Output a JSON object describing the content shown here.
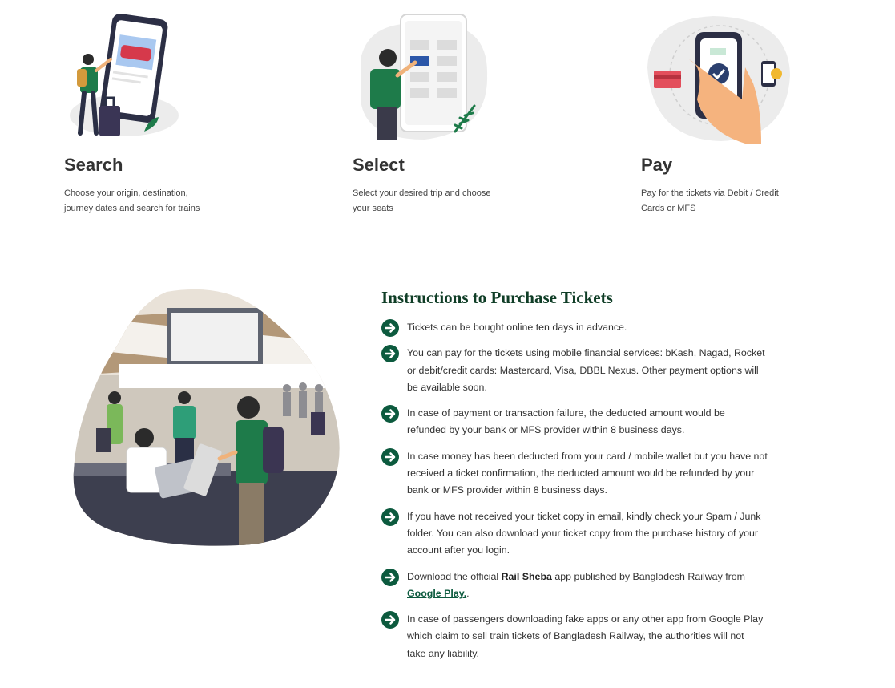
{
  "steps": [
    {
      "title": "Search",
      "description_line1": "Choose your origin, destination,",
      "description_line2": "journey dates and search for trains",
      "icon": "search-illustration"
    },
    {
      "title": "Select",
      "description_line1": "Select your desired trip and choose",
      "description_line2": "your seats",
      "icon": "select-illustration"
    },
    {
      "title": "Pay",
      "description_line1": "Pay for the tickets via Debit / Credit",
      "description_line2": "Cards or MFS",
      "icon": "pay-illustration"
    }
  ],
  "instructions": {
    "title": "Instructions to Purchase Tickets",
    "items": [
      {
        "lines": [
          "Tickets can be bought online ten days in advance."
        ]
      },
      {
        "lines": [
          "You can pay for the tickets using mobile financial services: bKash, Nagad, Rocket",
          "or debit/credit cards: Mastercard, Visa, DBBL Nexus. Other payment options will",
          "be available soon."
        ]
      },
      {
        "lines": [
          "In case of payment or transaction failure, the deducted amount would be",
          "refunded by your bank or MFS provider within 8 business days."
        ]
      },
      {
        "lines": [
          "In case money has been deducted from your card / mobile wallet but you have not",
          "received a ticket confirmation, the deducted amount would be refunded by your",
          "bank or MFS provider within 8 business days."
        ]
      },
      {
        "lines": [
          "If you have not received your ticket copy in email, kindly check your Spam / Junk",
          "folder. You can also download your ticket copy from the purchase history of your",
          "account after you login."
        ]
      },
      {
        "prefix": "Download the official ",
        "app_name": "Rail Sheba",
        "suffix": " app published by Bangladesh Railway from",
        "link_text": "Google Play.",
        "end": "."
      },
      {
        "lines": [
          "In case of passengers downloading fake apps or any other app from Google Play",
          "which claim to sell train tickets of Bangladesh Railway, the authorities will not",
          "take any liability."
        ]
      }
    ]
  },
  "colors": {
    "accent": "#0c5a3e",
    "title": "#0f3d26",
    "text": "#333333"
  }
}
